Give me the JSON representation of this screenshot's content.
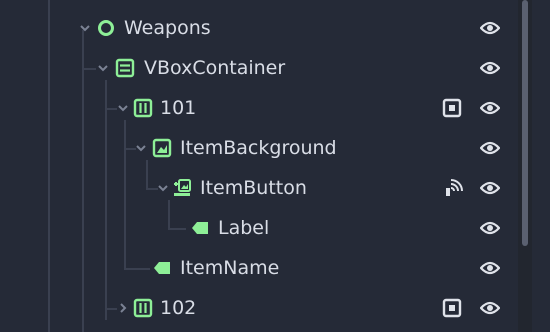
{
  "scene_tree": {
    "nodes": [
      {
        "name": "Weapons",
        "icon": "circle-node-icon",
        "expanded": true
      },
      {
        "name": "VBoxContainer",
        "icon": "vbox-container-icon",
        "expanded": true
      },
      {
        "name": "101",
        "icon": "grid-container-icon",
        "expanded": true,
        "extra_icon": "unique-name-icon"
      },
      {
        "name": "ItemBackground",
        "icon": "texture-rect-icon",
        "expanded": true
      },
      {
        "name": "ItemButton",
        "icon": "texture-button-icon",
        "expanded": true,
        "extra_icon": "signal-icon"
      },
      {
        "name": "Label",
        "icon": "label-icon",
        "expanded": false
      },
      {
        "name": "ItemName",
        "icon": "label-icon",
        "expanded": false
      },
      {
        "name": "102",
        "icon": "grid-container-icon",
        "expanded": false,
        "extra_icon": "unique-name-icon"
      }
    ]
  },
  "colors": {
    "background": "#252a37",
    "text": "#d9dde6",
    "accent_green": "#8eef97",
    "guide_line": "#3a4050",
    "icon_white": "#e0e3ea"
  }
}
